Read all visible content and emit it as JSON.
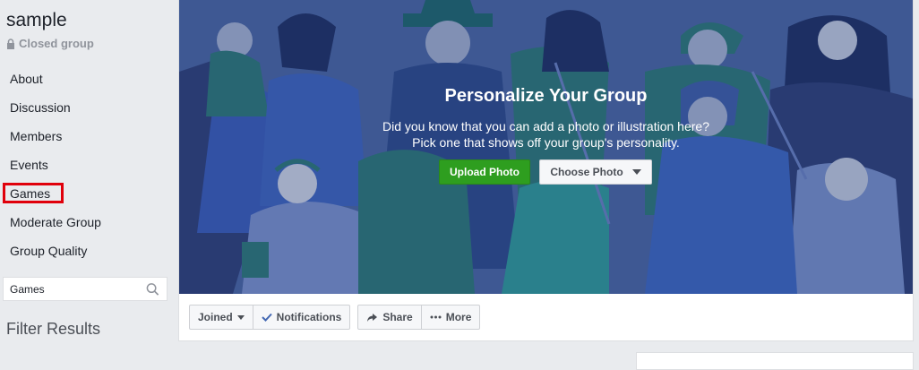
{
  "group": {
    "name": "sample",
    "privacy": "Closed group"
  },
  "nav": {
    "items": [
      {
        "label": "About"
      },
      {
        "label": "Discussion"
      },
      {
        "label": "Members"
      },
      {
        "label": "Events"
      },
      {
        "label": "Games"
      },
      {
        "label": "Moderate Group"
      },
      {
        "label": "Group Quality"
      }
    ]
  },
  "search": {
    "value": "Games",
    "icon": "search-icon"
  },
  "filter_results": "Filter Results",
  "cover": {
    "title": "Personalize Your Group",
    "subtitle_line1": "Did you know that you can add a photo or illustration here?",
    "subtitle_line2": "Pick one that shows off your group's personality.",
    "upload_label": "Upload Photo",
    "choose_label": "Choose Photo"
  },
  "actions": {
    "joined_label": "Joined",
    "notifications_label": "Notifications",
    "share_label": "Share",
    "more_label": "More"
  },
  "colors": {
    "accent_green": "#2e9e1f",
    "cover_blue": "#4a67a8",
    "highlight_red": "#e0000b",
    "check_blue": "#4267b2"
  }
}
